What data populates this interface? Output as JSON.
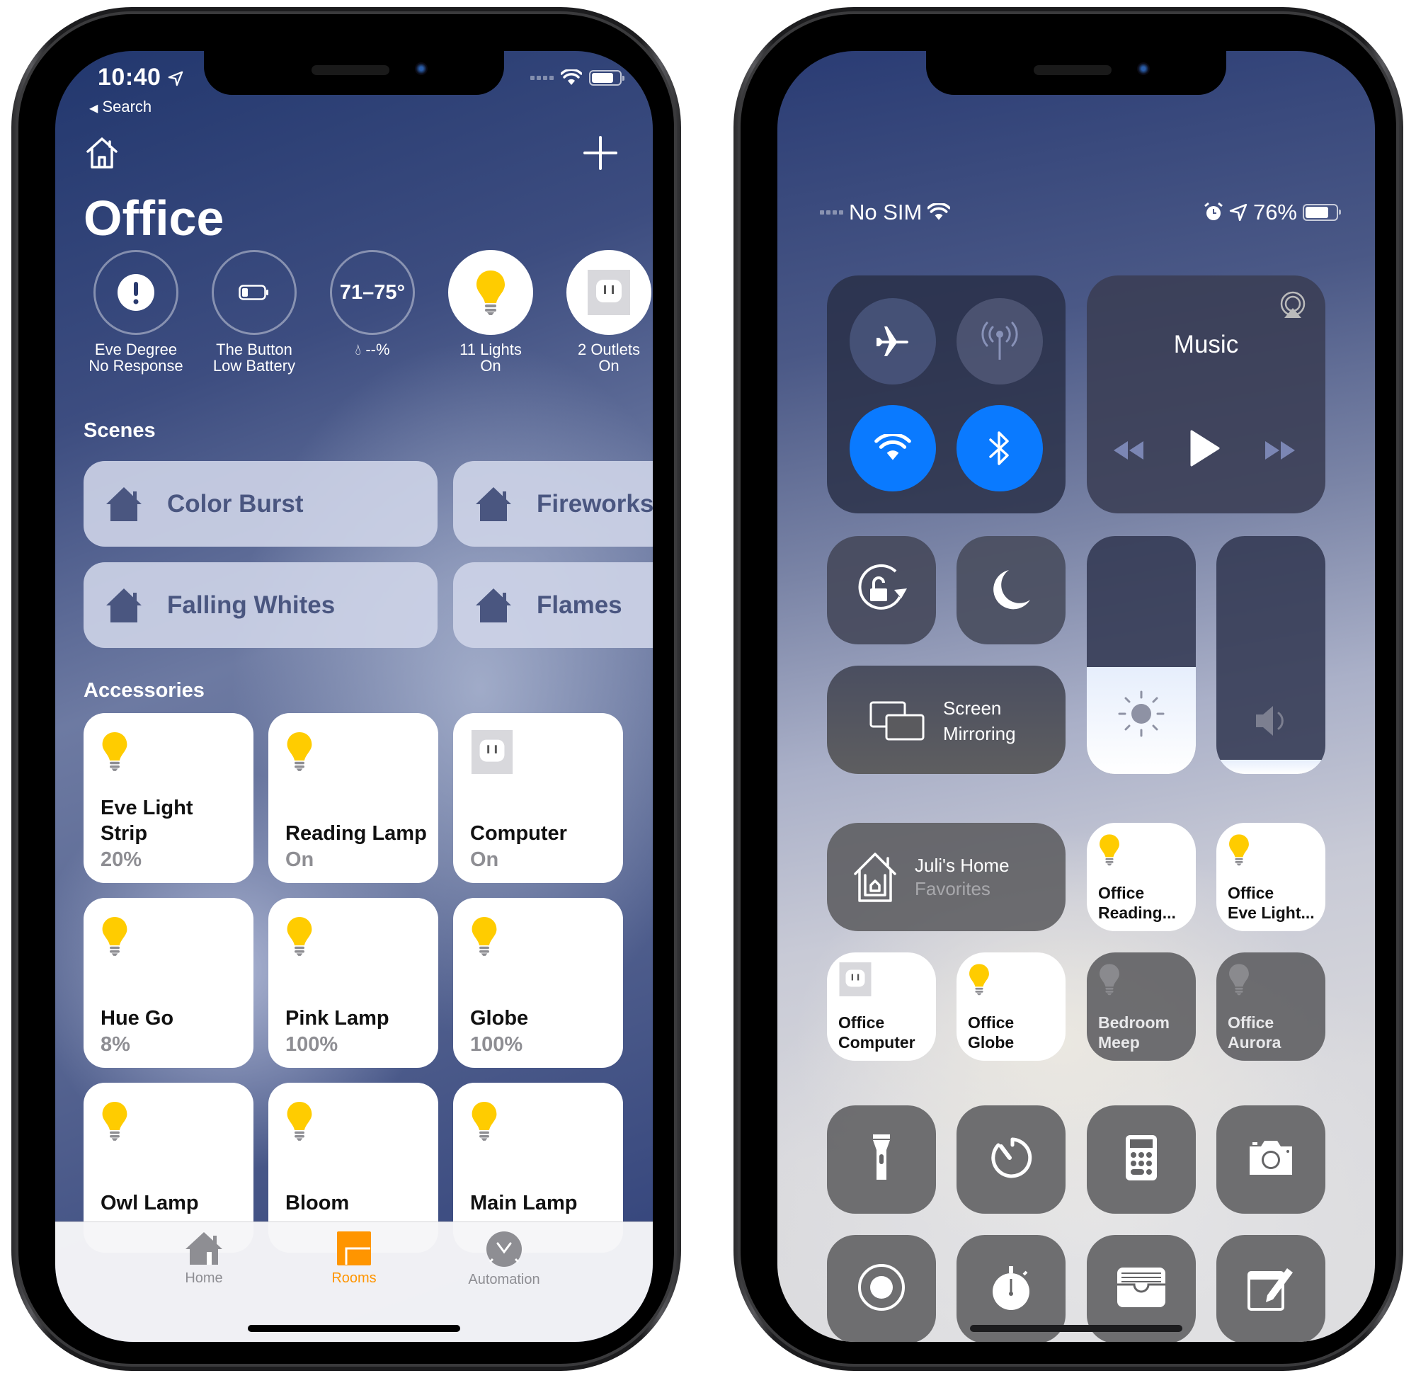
{
  "left_phone": {
    "app": "Home",
    "status_bar": {
      "time": "10:40",
      "back_label": "Search",
      "battery_icon": "battery-icon",
      "wifi_icon": "wifi-icon"
    },
    "header": {
      "home_icon": "house-outline-icon",
      "add_icon": "plus-icon",
      "title": "Office"
    },
    "status_items": [
      {
        "icon": "exclamation-icon",
        "value": "",
        "line1": "Eve Degree",
        "line2": "No Response",
        "on": false
      },
      {
        "icon": "low-battery-icon",
        "value": "",
        "line1": "The Button",
        "line2": "Low Battery",
        "on": false
      },
      {
        "icon": "temperature",
        "value": "71–75°",
        "line1": "--%",
        "line2": "",
        "on": false
      },
      {
        "icon": "lightbulb-icon",
        "value": "",
        "line1": "11 Lights",
        "line2": "On",
        "on": true
      },
      {
        "icon": "outlet-icon",
        "value": "",
        "line1": "2 Outlets",
        "line2": "On",
        "on": true
      }
    ],
    "scenes_title": "Scenes",
    "scenes": [
      {
        "label": "Color Burst"
      },
      {
        "label": "Fireworks"
      },
      {
        "label": "Falling Whites"
      },
      {
        "label": "Flames"
      }
    ],
    "accessories_title": "Accessories",
    "accessories": [
      {
        "name": "Eve Light Strip",
        "status": "20%",
        "type": "light"
      },
      {
        "name": "Reading Lamp",
        "status": "On",
        "type": "light"
      },
      {
        "name": "Computer",
        "status": "On",
        "type": "outlet"
      },
      {
        "name": "Hue Go",
        "status": "8%",
        "type": "light"
      },
      {
        "name": "Pink Lamp",
        "status": "100%",
        "type": "light"
      },
      {
        "name": "Globe",
        "status": "100%",
        "type": "light"
      },
      {
        "name": "Owl Lamp",
        "status": "",
        "type": "light"
      },
      {
        "name": "Bloom",
        "status": "",
        "type": "light"
      },
      {
        "name": "Main Lamp",
        "status": "",
        "type": "light"
      }
    ],
    "tabs": [
      {
        "label": "Home",
        "active": false
      },
      {
        "label": "Rooms",
        "active": true
      },
      {
        "label": "Automation",
        "active": false
      }
    ],
    "colors": {
      "accent": "#ff9500",
      "bulb": "#ffcc00",
      "scene_text": "#4a5680"
    }
  },
  "right_phone": {
    "app": "Control Center",
    "status_bar": {
      "carrier": "No SIM",
      "battery_percent": "76%"
    },
    "connectivity": {
      "airplane": {
        "icon": "airplane-icon",
        "on": false
      },
      "cellular": {
        "icon": "cellular-antenna-icon",
        "on": false
      },
      "wifi": {
        "icon": "wifi-icon",
        "on": true
      },
      "bluetooth": {
        "icon": "bluetooth-icon",
        "on": true
      }
    },
    "music": {
      "title": "Music",
      "airplay_icon": "airplay-icon",
      "rewind_icon": "rewind-icon",
      "play_icon": "play-icon",
      "forward_icon": "fast-forward-icon"
    },
    "orientation_lock_icon": "orientation-lock-icon",
    "do_not_disturb_icon": "moon-icon",
    "screen_mirroring": {
      "line1": "Screen",
      "line2": "Mirroring"
    },
    "brightness_level": 0.45,
    "volume_level": 0.06,
    "home": {
      "title": "Juli's Home",
      "subtitle": "Favorites"
    },
    "favorites": [
      {
        "line1": "Office",
        "line2": "Reading...",
        "type": "light",
        "on": true
      },
      {
        "line1": "Office",
        "line2": "Eve Light...",
        "type": "light",
        "on": true
      },
      {
        "line1": "Office",
        "line2": "Computer",
        "type": "outlet",
        "on": true
      },
      {
        "line1": "Office",
        "line2": "Globe",
        "type": "light",
        "on": true
      },
      {
        "line1": "Bedroom",
        "line2": "Meep",
        "type": "light",
        "on": false
      },
      {
        "line1": "Office",
        "line2": "Aurora",
        "type": "light",
        "on": false
      }
    ],
    "utilities": [
      {
        "icon": "flashlight-icon"
      },
      {
        "icon": "timer-icon"
      },
      {
        "icon": "calculator-icon"
      },
      {
        "icon": "camera-icon"
      },
      {
        "icon": "screen-record-icon"
      },
      {
        "icon": "stopwatch-icon"
      },
      {
        "icon": "wallet-icon"
      },
      {
        "icon": "notes-icon"
      }
    ],
    "colors": {
      "active_blue": "#0a7aff"
    }
  }
}
